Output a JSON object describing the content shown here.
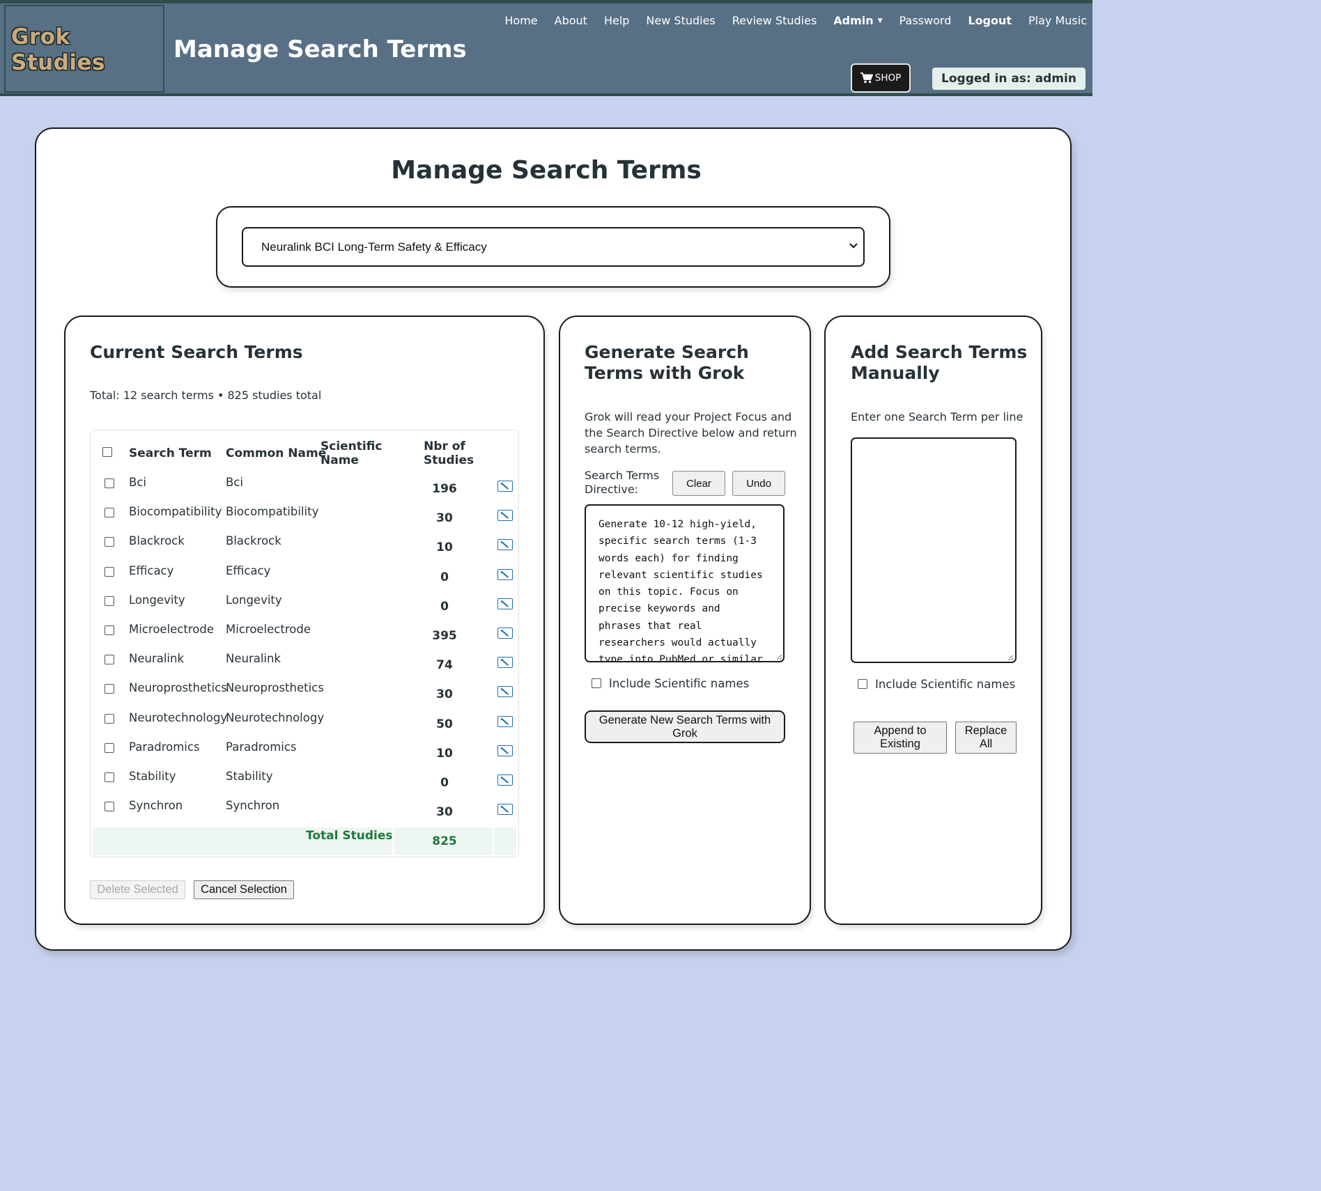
{
  "app": {
    "logo_line1": "Grok",
    "logo_line2": "Studies",
    "page_heading": "Manage Search Terms"
  },
  "nav": {
    "items": [
      "Home",
      "About",
      "Help",
      "New Studies",
      "Review Studies",
      "Admin",
      "Password",
      "Logout",
      "Play Music"
    ]
  },
  "shop": {
    "label": "SHOP",
    "icon": "cart-icon"
  },
  "login": {
    "text": "Logged in as: admin"
  },
  "main": {
    "title": "Manage Search Terms",
    "project_select": {
      "selected": "Neuralink BCI Long-Term Safety & Efficacy"
    }
  },
  "current": {
    "title": "Current Search Terms",
    "totals": "Total: 12 search terms • 825 studies total",
    "columns": {
      "term": "Search Term",
      "common": "Common Name",
      "scientific_1": "Scientific",
      "scientific_2": "Name",
      "studies_1": "Nbr of",
      "studies_2": "Studies"
    },
    "rows": [
      {
        "term": "Bci",
        "common": "Bci",
        "studies": "196"
      },
      {
        "term": "Biocompatibility",
        "common": "Biocompatibility",
        "studies": "30"
      },
      {
        "term": "Blackrock",
        "common": "Blackrock",
        "studies": "10"
      },
      {
        "term": "Efficacy",
        "common": "Efficacy",
        "studies": "0"
      },
      {
        "term": "Longevity",
        "common": "Longevity",
        "studies": "0"
      },
      {
        "term": "Microelectrode",
        "common": "Microelectrode",
        "studies": "395"
      },
      {
        "term": "Neuralink",
        "common": "Neuralink",
        "studies": "74"
      },
      {
        "term": "Neuroprosthetics",
        "common": "Neuroprosthetics",
        "studies": "30"
      },
      {
        "term": "Neurotechnology",
        "common": "Neurotechnology",
        "studies": "50"
      },
      {
        "term": "Paradromics",
        "common": "Paradromics",
        "studies": "10"
      },
      {
        "term": "Stability",
        "common": "Stability",
        "studies": "0"
      },
      {
        "term": "Synchron",
        "common": "Synchron",
        "studies": "30"
      }
    ],
    "total_label": "Total Studies",
    "total_value": "825",
    "delete_label": "Delete Selected",
    "cancel_label": "Cancel Selection"
  },
  "generate": {
    "title_line1": "Generate Search",
    "title_line2": "Terms with Grok",
    "desc_line1": "Grok will read your Project Focus and",
    "desc_line2": "the Search Directive below and return",
    "desc_line3": "search terms.",
    "directive_label_1": "Search Terms",
    "directive_label_2": "Directive:",
    "clear_label": "Clear",
    "undo_label": "Undo",
    "directive_lines": [
      "Generate 10-12 high-yield,",
      "specific search terms (1-3",
      "words each) for finding",
      "relevant scientific studies",
      "on this topic. Focus on",
      "precise keywords and",
      "phrases that real",
      "researchers would actually",
      "type into PubMed or similar"
    ],
    "include_scientific": "Include Scientific names",
    "generate_btn_1": "Generate New Search Terms with",
    "generate_btn_2": "Grok"
  },
  "manual": {
    "title_line1": "Add Search Terms",
    "title_line2": "Manually",
    "hint": "Enter one Search Term per line",
    "input_value": "",
    "include_scientific": "Include Scientific names",
    "append_1": "Append to",
    "append_2": "Existing",
    "replace_1": "Replace",
    "replace_2": "All"
  },
  "colors": {
    "header_bg": "#587086",
    "page_bg": "#c7d2ee",
    "total_green": "#1e7a3a",
    "edit_blue": "#1d6fb5"
  }
}
